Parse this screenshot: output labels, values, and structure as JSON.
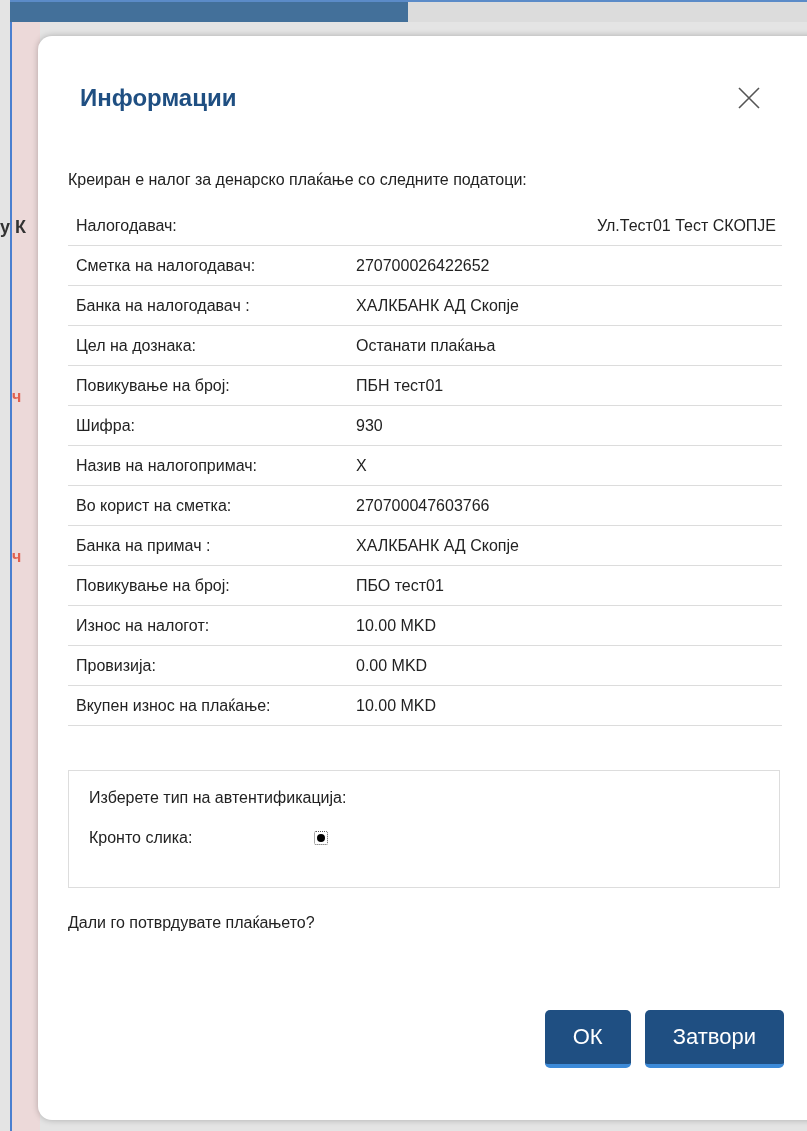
{
  "background": {
    "fragments": [
      {
        "text": "у К",
        "kind": "heading"
      },
      {
        "text": "ч",
        "kind": "required"
      },
      {
        "text": "ч",
        "kind": "required"
      }
    ]
  },
  "dialog": {
    "title": "Информации",
    "intro": "Креиран е налог за денарско плаќање со следните податоци:",
    "rows": [
      {
        "label": "Налогодавач:",
        "value": "Ул.Тест01 Тест СКОПЈЕ",
        "kind": "right"
      },
      {
        "label": "Сметка на налогодавач:",
        "value": "270700026422652",
        "kind": "plain"
      },
      {
        "label": "Банка на налогодавач :",
        "value": "ХАЛКБАНК АД Скопје",
        "kind": "plain"
      },
      {
        "label": "Цел на дознака:",
        "value": "Останати плаќања",
        "kind": "plain"
      },
      {
        "label": "Повикување на број:",
        "value": "ПБН тест01",
        "kind": "plain"
      },
      {
        "label": "Шифра:",
        "value": "930",
        "kind": "plain"
      },
      {
        "label": "Назив на налогопримач:",
        "value": "X",
        "kind": "plain"
      },
      {
        "label": "Во корист на сметка:",
        "value": "270700047603766",
        "kind": "plain"
      },
      {
        "label": "Банка на примач :",
        "value": "ХАЛКБАНК АД Скопје",
        "kind": "plain"
      },
      {
        "label": "Повикување на број:",
        "value": "ПБО тест01",
        "kind": "plain"
      },
      {
        "label": "Износ на налогот:",
        "value": "10.00 MKD",
        "kind": "plain"
      },
      {
        "label": "Провизија:",
        "value": "0.00 MKD",
        "kind": "plain"
      },
      {
        "label": "Вкупен износ на плаќање:",
        "value": "10.00 MKD",
        "kind": "plain"
      }
    ],
    "auth": {
      "heading": "Изберете тип на автентификација:",
      "options": [
        {
          "label": "Кронто слика:",
          "selected": true
        }
      ]
    },
    "question": "Дали го потврдувате плаќањето?",
    "buttons": [
      "ОК",
      "Затвори"
    ]
  }
}
